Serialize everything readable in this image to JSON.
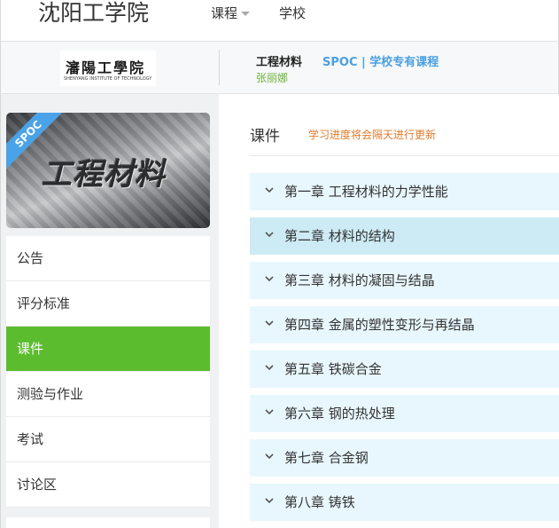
{
  "topbar": {
    "site_title": "沈阳工学院",
    "nav": [
      {
        "label": "课程",
        "has_dropdown": true
      },
      {
        "label": "学校",
        "has_dropdown": false
      }
    ]
  },
  "course_header": {
    "logo_cn": "瀋陽工學院",
    "logo_en": "SHENYANG INSTITUTE OF TECHNOLOGY",
    "course_name": "工程材料",
    "course_type": "SPOC | 学校专有课程",
    "teacher": "张丽娜"
  },
  "cover": {
    "ribbon": "SPOC",
    "title": "工程材料"
  },
  "sidebar": {
    "items": [
      {
        "label": "公告",
        "active": false
      },
      {
        "label": "评分标准",
        "active": false
      },
      {
        "label": "课件",
        "active": true
      },
      {
        "label": "测验与作业",
        "active": false
      },
      {
        "label": "考试",
        "active": false
      },
      {
        "label": "讨论区",
        "active": false
      }
    ]
  },
  "content": {
    "title": "课件",
    "note": "学习进度将会隔天进行更新",
    "chapters": [
      "第一章 工程材料的力学性能",
      "第二章 材料的结构",
      "第三章 材料的凝固与结晶",
      "第四章 金属的塑性变形与再结晶",
      "第五章 铁碳合金",
      "第六章 钢的热处理",
      "第七章 合金钢",
      "第八章 铸铁"
    ]
  },
  "colors": {
    "accent_green": "#5bbc2e",
    "spoc_blue": "#4a9fe0",
    "note_orange": "#e07a2c",
    "chapter_bg": "#e8f7fd",
    "chapter_hover_bg": "#cdebf5"
  },
  "icons": {
    "dropdown": "caret-down-icon",
    "chapter_toggle": "chevron-down-icon"
  }
}
